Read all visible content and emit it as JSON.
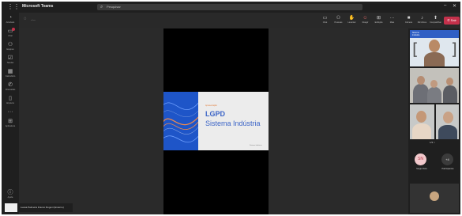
{
  "app": {
    "title": "Microsoft Teams"
  },
  "search": {
    "placeholder": "Pesquisar"
  },
  "window_controls": {
    "minimize": "–",
    "close": "✕"
  },
  "rail": [
    {
      "label": "Atividade",
      "icon": "bell-icon"
    },
    {
      "label": "Chat",
      "icon": "chat-icon"
    },
    {
      "label": "Equipes",
      "icon": "teams-icon"
    },
    {
      "label": "Tarefas",
      "icon": "tasks-icon"
    },
    {
      "label": "Calendário",
      "icon": "calendar-icon"
    },
    {
      "label": "Chamadas",
      "icon": "phone-icon"
    },
    {
      "label": "Arquivos",
      "icon": "files-icon"
    },
    {
      "label": "",
      "icon": "more-icon"
    },
    {
      "label": "Aplicativos",
      "icon": "apps-icon"
    },
    {
      "label": "Ajuda",
      "icon": "help-icon"
    }
  ],
  "meeting": {
    "timer": "–:––",
    "toolbar": [
      {
        "label": "Chat",
        "icon": "chat-icon"
      },
      {
        "label": "Pessoas",
        "icon": "people-icon"
      },
      {
        "label": "Levantar",
        "icon": "raise-hand-icon"
      },
      {
        "label": "Reagir",
        "icon": "react-icon"
      },
      {
        "label": "Exibição",
        "icon": "view-icon"
      },
      {
        "label": "Mais",
        "icon": "more-icon"
      },
      {
        "label": "Câmera",
        "icon": "camera-icon"
      },
      {
        "label": "Microfone",
        "icon": "mic-icon"
      },
      {
        "label": "Compartilhar",
        "icon": "share-icon"
      }
    ],
    "leave_label": "Sair"
  },
  "slide": {
    "small_text": "Apresentação",
    "title_line1": "LGPD",
    "title_line2": "Sistema Indústria",
    "footer": "Sistema Indústria"
  },
  "panel": {
    "tile1_overlay": "Sistema\nIndústria",
    "pager": "1/3  >",
    "avatar_initials": "SN",
    "avatar_name": "Sergio Neto",
    "more_count": "+4",
    "more_label": "Participantes"
  },
  "toast": {
    "text": "Luana Palmeira Franco Rogoni (Externo)"
  },
  "colors": {
    "leave": "#c4314b",
    "accent": "#3b64c7",
    "orange": "#e27b38"
  }
}
